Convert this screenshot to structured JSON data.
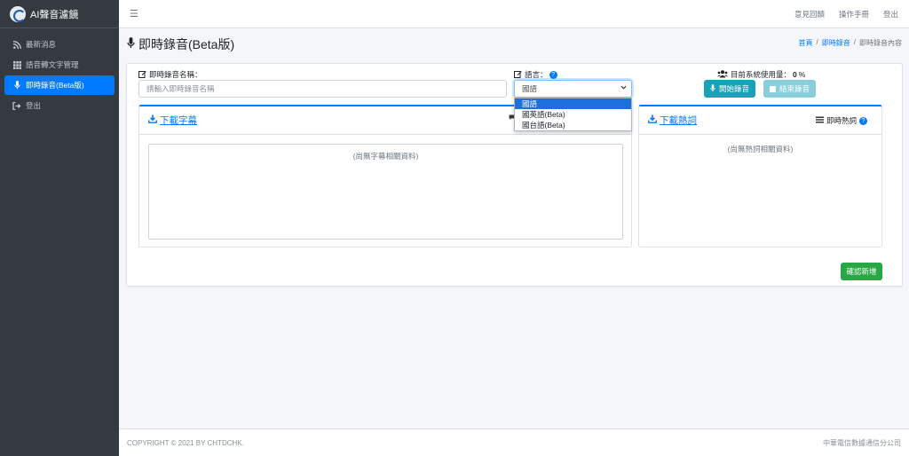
{
  "app": {
    "title": "AI聲音濾鏡"
  },
  "sidebar": {
    "items": [
      {
        "label": "最新消息",
        "icon": "rss-icon"
      },
      {
        "label": "語音轉文字管理",
        "icon": "grid-icon"
      },
      {
        "label": "即時錄音(Beta版)",
        "icon": "microphone-icon"
      },
      {
        "label": "登出",
        "icon": "sign-out-icon"
      }
    ]
  },
  "topbar": {
    "links": [
      "意見回饋",
      "操作手冊",
      "登出"
    ]
  },
  "page": {
    "title": "即時錄音(Beta版)",
    "breadcrumb": {
      "home": "首頁",
      "parent": "即時錄音",
      "current": "即時錄音內容"
    }
  },
  "form": {
    "name_label": "即時錄音名稱：",
    "name_placeholder": "請輸入即時錄音名稱",
    "language_label": "語言：",
    "language_selected": "國語",
    "language_options": [
      "國語",
      "國英語(Beta)",
      "國台語(Beta)"
    ],
    "usage_label": "目前系統使用量：",
    "usage_value": "0",
    "usage_unit": "%",
    "start_label": "開始錄音",
    "stop_label": "結束錄音"
  },
  "subtitle_panel": {
    "download_label": "下載字幕",
    "empty_text": "(尚無字幕相關資料)"
  },
  "hotword_panel": {
    "download_label": "下載熱詞",
    "header_label": "即時熱詞",
    "empty_text": "(尚無熱詞相關資料)"
  },
  "confirm_label": "確認新增",
  "footer": {
    "copyright": "COPYRIGHT © 2021 BY CHTDCHK.",
    "company": "中華電信數據通信分公司"
  },
  "colors": {
    "primary": "#007bff",
    "info": "#17a2b8",
    "success": "#28a745",
    "sidebar": "#343a40"
  }
}
